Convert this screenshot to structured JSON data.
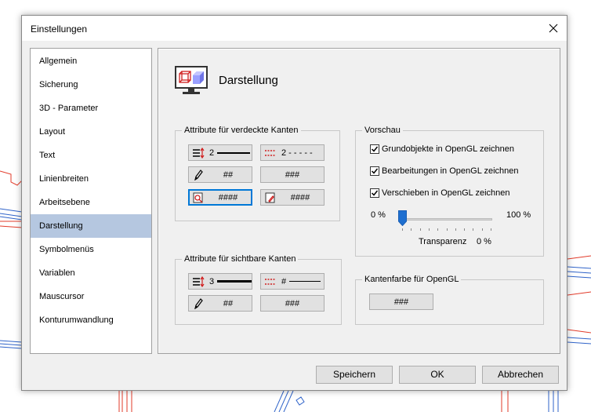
{
  "window": {
    "title": "Einstellungen"
  },
  "nav": {
    "items": [
      {
        "label": "Allgemein"
      },
      {
        "label": "Sicherung"
      },
      {
        "label": "3D - Parameter"
      },
      {
        "label": "Layout"
      },
      {
        "label": "Text"
      },
      {
        "label": "Linienbreiten"
      },
      {
        "label": "Arbeitsebene"
      },
      {
        "label": "Darstellung",
        "selected": true
      },
      {
        "label": "Symbolmenüs"
      },
      {
        "label": "Variablen"
      },
      {
        "label": "Mauscursor"
      },
      {
        "label": "Konturumwandlung"
      }
    ]
  },
  "page": {
    "title": "Darstellung"
  },
  "hidden_edges": {
    "legend": "Attribute für verdeckte Kanten",
    "width_value": "2",
    "style_value": "2 - - - - -",
    "pen_value": "##",
    "color_value": "###",
    "layer_value": "####",
    "layer2_value": "####"
  },
  "visible_edges": {
    "legend": "Attribute für sichtbare Kanten",
    "width_value": "3",
    "style_value": "#",
    "pen_value": "##",
    "color_value": "###"
  },
  "preview": {
    "legend": "Vorschau",
    "options": [
      {
        "label": "Grundobjekte in OpenGL zeichnen",
        "checked": true
      },
      {
        "label": "Bearbeitungen in OpenGL zeichnen",
        "checked": true
      },
      {
        "label": "Verschieben in OpenGL zeichnen",
        "checked": true
      }
    ],
    "slider_min_label": "0 %",
    "slider_max_label": "100 %",
    "transparency_label": "Transparenz",
    "transparency_value": "0 %",
    "transparency": 0
  },
  "edge_color": {
    "legend": "Kantenfarbe für OpenGL",
    "value": "###"
  },
  "footer": {
    "save_label": "Speichern",
    "ok_label": "OK",
    "cancel_label": "Abbrechen"
  },
  "colors": {
    "selection": "#b5c7e0",
    "focus": "#0078d7",
    "slider_thumb": "#1e6fd0"
  }
}
